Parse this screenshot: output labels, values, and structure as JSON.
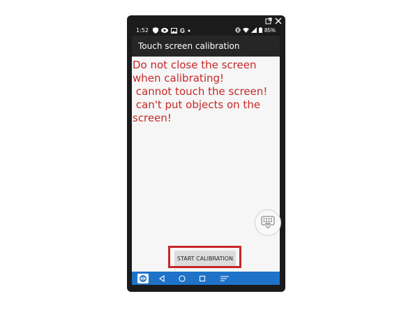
{
  "status_bar": {
    "time": "1:52",
    "g_label": "G",
    "battery": "85%"
  },
  "app_bar": {
    "title": "Touch screen calibration"
  },
  "content": {
    "warning_text": "Do not close the screen when calibrating!\n cannot touch the screen!\n can't put objects on the screen!",
    "start_button_label": "START CALIBRATION"
  },
  "colors": {
    "warning": "#c62828",
    "highlight": "#c62828",
    "navbar": "#1e73c8",
    "appbar": "#262626"
  },
  "icons": {
    "window": [
      "popout-icon",
      "close-icon"
    ],
    "status_left": [
      "shield-icon",
      "eye-icon",
      "image-icon",
      "google-icon",
      "dot-icon"
    ],
    "status_right": [
      "vibrate-icon",
      "wifi-icon",
      "signal-icon",
      "battery-icon"
    ],
    "nav": [
      "teamviewer-icon",
      "back-icon",
      "home-icon",
      "recents-icon",
      "menu-icon"
    ],
    "content": [
      "keyboard-icon"
    ]
  }
}
